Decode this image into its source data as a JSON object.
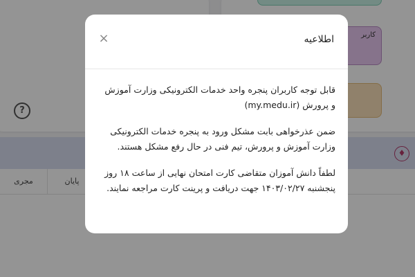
{
  "background": {
    "help_icon": "?",
    "tile_purple_label": "کاربر",
    "bell_icon": "bell-icon",
    "table_headers": [
      "پایان",
      "مجری"
    ]
  },
  "notice_modal": {
    "title": "اطلاعیه",
    "close_icon": "×",
    "paragraphs": [
      "قابل توجه کاربران پنجره واحد خدمات الکترونیکی وزارت آموزش و پرورش (my.medu.ir)",
      "ضمن عذرخواهی بابت مشکل ورود به پنجره خدمات الکترونیکی وزارت آموزش و پرورش، تیم فنی در حال رفع مشکل هستند.",
      "لطفاً دانش آموزان متقاضی کارت امتحان نهایی از ساعت ۱۸ روز پنجشنبه ۱۴۰۳/۰۲/۲۷ جهت دریافت و پرینت کارت مراجعه نمایند."
    ]
  },
  "colors": {
    "overlay": "rgba(0,0,0,0.42)",
    "tile_green": "#c6efe3",
    "tile_purple": "#e7c6ef",
    "tile_orange": "#f8dfb8",
    "header_band": "#d7dcf0",
    "bell": "#b23a6a"
  }
}
